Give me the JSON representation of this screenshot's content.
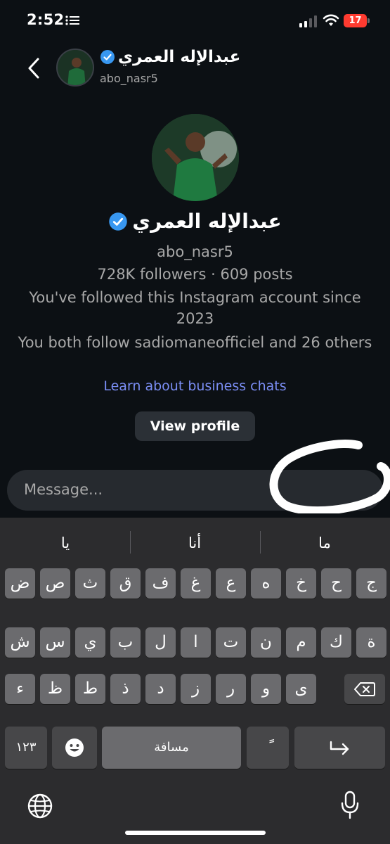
{
  "status_bar": {
    "time": "2:52",
    "battery": "17",
    "list_icon": "list-icon",
    "signal_icon": "cellular-signal-icon",
    "wifi_icon": "wifi-icon"
  },
  "header": {
    "name": "عبدالإله العمري",
    "username": "abo_nasr5",
    "back_icon": "chevron-left-icon",
    "verified_icon": "verified-badge-icon"
  },
  "profile": {
    "name": "عبدالإله العمري",
    "username": "abo_nasr5",
    "stats": "728K followers · 609 posts",
    "followed_since": "You've followed this Instagram account since 2023",
    "mutual": "You both follow sadiomaneofficiel and 26 others",
    "learn_link": "Learn about business chats",
    "view_profile_label": "View profile"
  },
  "composer": {
    "placeholder": "Message..."
  },
  "keyboard": {
    "suggestions": [
      "يا",
      "أنا",
      "ما"
    ],
    "row1": [
      "ض",
      "ص",
      "ث",
      "ق",
      "ف",
      "غ",
      "ع",
      "ه",
      "خ",
      "ح",
      "ج"
    ],
    "row2": [
      "ش",
      "س",
      "ي",
      "ب",
      "ل",
      "ا",
      "ت",
      "ن",
      "م",
      "ك",
      "ة"
    ],
    "row3": [
      "ء",
      "ظ",
      "ط",
      "ذ",
      "د",
      "ز",
      "ر",
      "و",
      "ى"
    ],
    "numbers_label": "١٢٣",
    "space_label": "مسافة",
    "diacritic_label": "ً",
    "emoji_icon": "emoji-icon",
    "return_icon": "return-arrow-icon",
    "delete_icon": "delete-backspace-icon",
    "globe_icon": "globe-icon",
    "mic_icon": "microphone-icon"
  },
  "colors": {
    "background": "#0c1014",
    "link": "#7b8ef5",
    "verified": "#3897f0",
    "battery": "#ff3b30"
  }
}
